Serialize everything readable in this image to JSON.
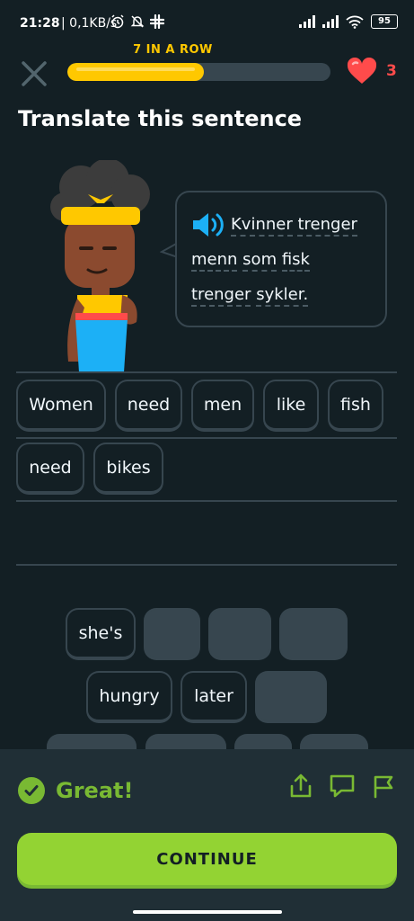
{
  "status_bar": {
    "time": "21:28",
    "network_speed": "| 0,1KB/s",
    "battery": "95"
  },
  "lesson": {
    "streak_label": "7 IN A ROW",
    "progress_percent": 52,
    "hearts": "3",
    "title": "Translate this sentence"
  },
  "prompt": {
    "lines": [
      [
        "Kvinner",
        "trenger"
      ],
      [
        "menn",
        "som",
        "fisk"
      ],
      [
        "trenger",
        "sykler."
      ]
    ]
  },
  "answer_tiles": [
    "Women",
    "need",
    "men",
    "like",
    "fish",
    "need",
    "bikes"
  ],
  "bank_tiles": [
    "she's",
    "hungry",
    "later"
  ],
  "footer": {
    "feedback": "Great!",
    "continue_label": "CONTINUE"
  },
  "colors": {
    "background": "#131f24",
    "streak": "#ffc800",
    "heart": "#ff4b4b",
    "success": "#79b933",
    "continue": "#93d333",
    "footer": "#202f36"
  }
}
